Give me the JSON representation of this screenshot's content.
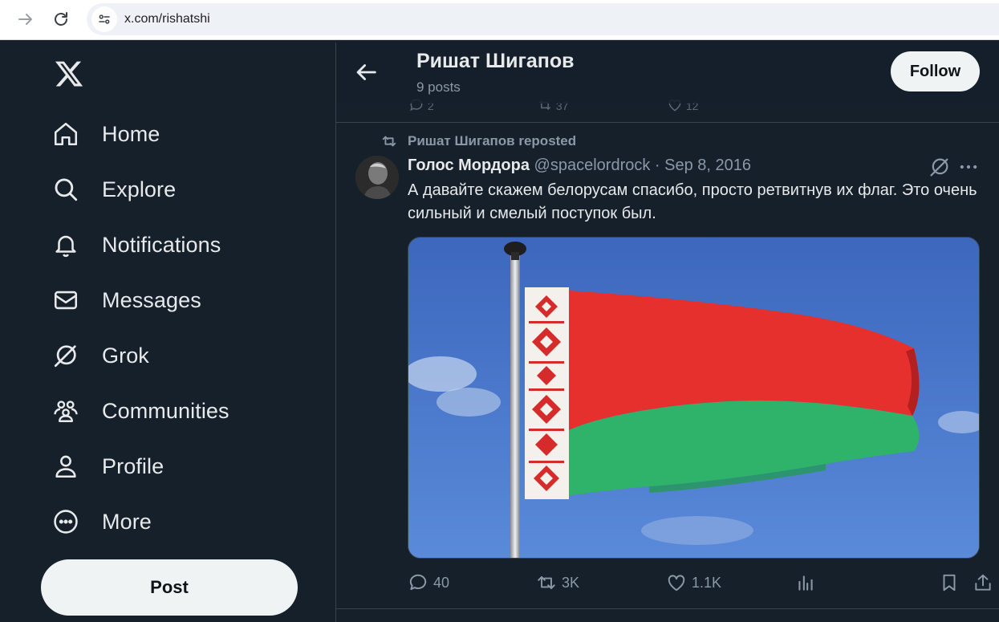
{
  "browser": {
    "url": "x.com/rishatshi"
  },
  "sidebar": {
    "items": [
      {
        "label": "Home",
        "icon": "home-icon"
      },
      {
        "label": "Explore",
        "icon": "search-icon"
      },
      {
        "label": "Notifications",
        "icon": "bell-icon"
      },
      {
        "label": "Messages",
        "icon": "envelope-icon"
      },
      {
        "label": "Grok",
        "icon": "grok-icon"
      },
      {
        "label": "Communities",
        "icon": "people-icon"
      },
      {
        "label": "Profile",
        "icon": "person-icon"
      },
      {
        "label": "More",
        "icon": "more-circle-icon"
      }
    ],
    "post_label": "Post"
  },
  "header": {
    "name": "Ришат Шигапов",
    "posts": "9 posts",
    "follow_label": "Follow"
  },
  "previous_tweet": {
    "replies": "2",
    "reposts": "37",
    "likes": "12"
  },
  "tweet": {
    "repost_text": "Ришат Шигапов reposted",
    "author": "Голос Мордора",
    "handle": "@spacelordrock",
    "separator": "·",
    "date": "Sep 8, 2016",
    "text": "А давайте скажем белорусам спасибо, просто ретвитнув их флаг. Это очень сильный и смелый поступок был.",
    "media": "belarus-flag-photo",
    "replies": "40",
    "reposts": "3K",
    "likes": "1.1K"
  },
  "colors": {
    "background": "#15202b",
    "text": "#e7e9ea",
    "muted": "#8b98a5",
    "border": "#38444d",
    "flag_red": "#e5302e",
    "flag_green": "#2fb36a"
  }
}
